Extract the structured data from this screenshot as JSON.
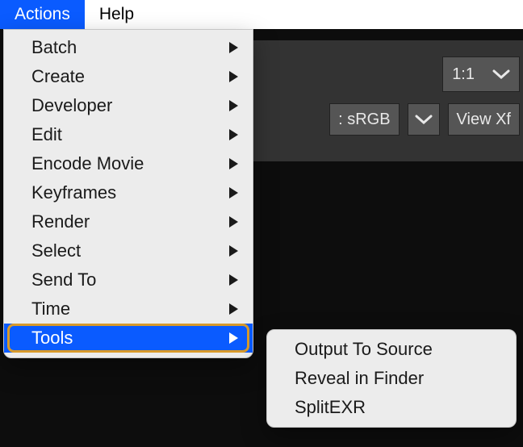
{
  "menubar": {
    "actions": "Actions",
    "help": "Help"
  },
  "panel": {
    "zoom": "1:1",
    "colorspace": ": sRGB",
    "viewxf": "View Xf"
  },
  "actions_menu": {
    "items": [
      {
        "label": "Batch"
      },
      {
        "label": "Create"
      },
      {
        "label": "Developer"
      },
      {
        "label": "Edit"
      },
      {
        "label": "Encode Movie"
      },
      {
        "label": "Keyframes"
      },
      {
        "label": "Render"
      },
      {
        "label": "Select"
      },
      {
        "label": "Send To"
      },
      {
        "label": "Time"
      },
      {
        "label": "Tools"
      }
    ]
  },
  "tools_submenu": {
    "items": [
      {
        "label": "Output To Source"
      },
      {
        "label": "Reveal in Finder"
      },
      {
        "label": "SplitEXR"
      }
    ]
  }
}
